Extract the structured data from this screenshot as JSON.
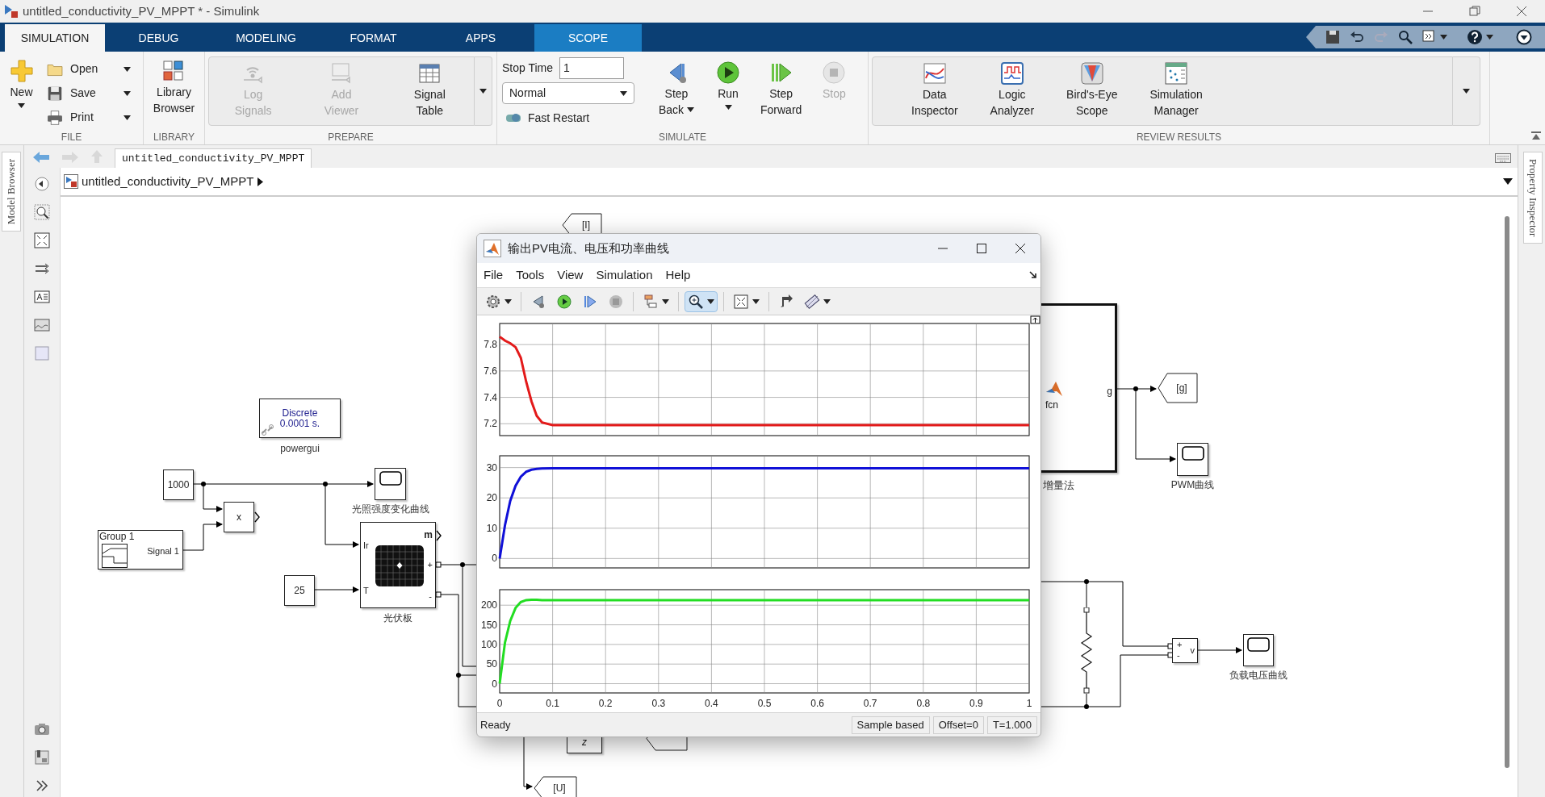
{
  "window": {
    "title": "untitled_conductivity_PV_MPPT * - Simulink"
  },
  "tabs": [
    {
      "label": "SIMULATION",
      "selected": true,
      "kind": "normal"
    },
    {
      "label": "DEBUG",
      "selected": false,
      "kind": "normal"
    },
    {
      "label": "MODELING",
      "selected": false,
      "kind": "normal"
    },
    {
      "label": "FORMAT",
      "selected": false,
      "kind": "normal"
    },
    {
      "label": "APPS",
      "selected": false,
      "kind": "normal"
    },
    {
      "label": "SCOPE",
      "selected": false,
      "kind": "contextual"
    }
  ],
  "file": {
    "label": "FILE",
    "new_button": "New",
    "items": [
      {
        "label": "Open",
        "kind": "open"
      },
      {
        "label": "Save",
        "kind": "save"
      },
      {
        "label": "Print",
        "kind": "print"
      }
    ]
  },
  "library": {
    "label": "LIBRARY",
    "button": {
      "lines": [
        "Library",
        "Browser"
      ],
      "kind": "library"
    }
  },
  "prepare": {
    "label": "PREPARE",
    "buttons": [
      {
        "lines": [
          "Log",
          "Signals"
        ],
        "kind": "log_signals",
        "disabled": true
      },
      {
        "lines": [
          "Add",
          "Viewer"
        ],
        "kind": "add_viewer",
        "disabled": true
      },
      {
        "lines": [
          "Signal",
          "Table"
        ],
        "kind": "signal_table",
        "disabled": false
      }
    ]
  },
  "simulate": {
    "label": "SIMULATE",
    "stop_time_label": "Stop Time",
    "stop_time": "1",
    "mode": "Normal",
    "fast_restart": "Fast Restart",
    "buttons": [
      {
        "lines": [
          "Step",
          "Back"
        ],
        "kind": "step_back",
        "disabled": false,
        "caret": true
      },
      {
        "lines": [
          "Run"
        ],
        "kind": "run",
        "disabled": false,
        "caret": true
      },
      {
        "lines": [
          "Step",
          "Forward"
        ],
        "kind": "step_forward",
        "disabled": false,
        "caret": false
      },
      {
        "lines": [
          "Stop"
        ],
        "kind": "stop",
        "disabled": true,
        "caret": false
      }
    ]
  },
  "review": {
    "label": "REVIEW RESULTS",
    "buttons": [
      {
        "lines": [
          "Data",
          "Inspector"
        ],
        "kind": "data_inspector"
      },
      {
        "lines": [
          "Logic",
          "Analyzer"
        ],
        "kind": "logic_analyzer"
      },
      {
        "lines": [
          "Bird's-Eye",
          "Scope"
        ],
        "kind": "birds_eye"
      },
      {
        "lines": [
          "Simulation",
          "Manager"
        ],
        "kind": "sim_manager"
      }
    ]
  },
  "editor": {
    "tab": "untitled_conductivity_PV_MPPT",
    "breadcrumb": "untitled_conductivity_PV_MPPT",
    "left_panel": "Model Browser",
    "right_panel": "Property Inspector"
  },
  "diagram": {
    "blocks": [
      {
        "kind": "powergui",
        "lines": [
          "Discrete",
          "0.0001 s."
        ],
        "label": "powergui"
      },
      {
        "kind": "constant",
        "text": "1000"
      },
      {
        "kind": "product",
        "text": "x"
      },
      {
        "kind": "signal_builder",
        "title": "Group 1",
        "signal": "Signal 1"
      },
      {
        "kind": "scope",
        "label": "光照强度变化曲线"
      },
      {
        "kind": "constant",
        "text": "25"
      },
      {
        "kind": "pv_array",
        "label": "光伏板",
        "ports": [
          "Ir",
          "T",
          "m",
          "+",
          "-"
        ]
      },
      {
        "kind": "goto",
        "text": "[I]"
      },
      {
        "kind": "subsystem",
        "text": "fcn",
        "port": "g",
        "label": "增量法"
      },
      {
        "kind": "goto",
        "text": "[g]"
      },
      {
        "kind": "scope",
        "label": "PWM曲线"
      },
      {
        "kind": "resistor"
      },
      {
        "kind": "voltage_sensor",
        "ports": [
          "+",
          "-",
          "v"
        ]
      },
      {
        "kind": "scope",
        "label": "负载电压曲线"
      },
      {
        "kind": "delay",
        "text": "z"
      },
      {
        "kind": "goto"
      },
      {
        "kind": "goto",
        "text": "[U]"
      }
    ]
  },
  "scope_window": {
    "title": "输出PV电流、电压和功率曲线",
    "menu": [
      "File",
      "Tools",
      "View",
      "Simulation",
      "Help"
    ],
    "toolbar": [
      {
        "kind": "settings",
        "caret": true,
        "selected": false
      },
      {
        "kind": "step_back",
        "caret": false,
        "selected": false
      },
      {
        "kind": "run",
        "caret": false,
        "selected": false
      },
      {
        "kind": "step_forward",
        "caret": false,
        "selected": false
      },
      {
        "kind": "stop",
        "caret": false,
        "selected": false
      },
      {
        "kind": "signals",
        "caret": true,
        "selected": false
      },
      {
        "kind": "zoom",
        "caret": true,
        "selected": true
      },
      {
        "kind": "fit",
        "caret": true,
        "selected": false
      },
      {
        "kind": "cursor",
        "caret": false,
        "selected": false
      },
      {
        "kind": "measure",
        "caret": true,
        "selected": false
      }
    ],
    "plots": [
      {
        "chart_data": {
          "type": "line",
          "grid": true,
          "x": [
            0,
            0.01,
            0.02,
            0.03,
            0.04,
            0.05,
            0.06,
            0.07,
            0.08,
            0.1,
            0.2,
            0.3,
            0.4,
            0.5,
            0.6,
            0.7,
            0.8,
            0.9,
            1
          ],
          "xlim": [
            0,
            1
          ],
          "ylim": [
            7.11,
            7.96
          ],
          "yticks": [
            7.2,
            7.4,
            7.6,
            7.8
          ],
          "series": [
            {
              "color": "#e31a1a",
              "values": [
                7.86,
                7.83,
                7.81,
                7.78,
                7.7,
                7.52,
                7.37,
                7.26,
                7.21,
                7.19,
                7.19,
                7.19,
                7.19,
                7.19,
                7.19,
                7.19,
                7.19,
                7.19,
                7.19
              ]
            }
          ]
        }
      },
      {
        "chart_data": {
          "type": "line",
          "grid": true,
          "x": [
            0,
            0.01,
            0.02,
            0.03,
            0.04,
            0.05,
            0.06,
            0.07,
            0.08,
            0.1,
            0.2,
            0.3,
            0.4,
            0.5,
            0.6,
            0.7,
            0.8,
            0.9,
            1
          ],
          "xlim": [
            0,
            1
          ],
          "ylim": [
            -3.1,
            33.9
          ],
          "yticks": [
            0,
            10,
            20,
            30
          ],
          "series": [
            {
              "color": "#1010d8",
              "values": [
                0,
                11,
                19,
                24,
                27,
                28.6,
                29.3,
                29.6,
                29.7,
                29.8,
                29.8,
                29.8,
                29.8,
                29.8,
                29.8,
                29.8,
                29.8,
                29.8,
                29.8
              ]
            }
          ]
        }
      },
      {
        "chart_data": {
          "type": "line",
          "grid": true,
          "x": [
            0,
            0.01,
            0.02,
            0.03,
            0.04,
            0.05,
            0.06,
            0.07,
            0.08,
            0.1,
            0.2,
            0.3,
            0.4,
            0.5,
            0.6,
            0.7,
            0.8,
            0.9,
            1
          ],
          "xlim": [
            0,
            1
          ],
          "ylim": [
            -23.6,
            239.5
          ],
          "xticks": [
            0,
            0.1,
            0.2,
            0.3,
            0.4,
            0.5,
            0.6,
            0.7,
            0.8,
            0.9,
            1
          ],
          "yticks": [
            0,
            50,
            100,
            150,
            200
          ],
          "series": [
            {
              "color": "#22dd22",
              "values": [
                0,
                105,
                160,
                193,
                208,
                213,
                214,
                214,
                213,
                213,
                213,
                213,
                213,
                213,
                213,
                213,
                213,
                213,
                213
              ]
            }
          ]
        }
      }
    ],
    "status": "Ready",
    "status_fields": [
      "Sample based",
      "Offset=0",
      "T=1.000"
    ]
  }
}
